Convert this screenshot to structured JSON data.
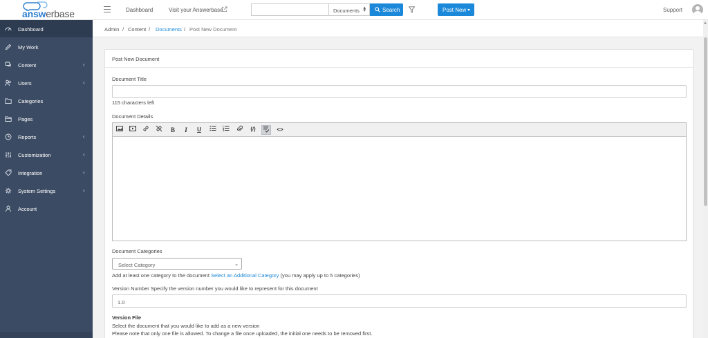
{
  "header": {
    "logo_text_1": "answ",
    "logo_text_2": "erbase",
    "nav_dashboard": "Dashboard",
    "nav_visit": "Visit your Answerbase",
    "search_value": "",
    "search_scope": "Documents",
    "search_button": "Search",
    "post_new": "Post New",
    "support": "Support",
    "accent_color": "#1b88d9"
  },
  "sidebar": {
    "background": "#3b4b63",
    "items": [
      {
        "label": "Dashboard",
        "icon": "speedometer-icon",
        "chevron": ""
      },
      {
        "label": "My Work",
        "icon": "pencil-icon",
        "chevron": ""
      },
      {
        "label": "Content",
        "icon": "chat-bubbles-icon",
        "chevron": "‹"
      },
      {
        "label": "Users",
        "icon": "users-icon",
        "chevron": "‹"
      },
      {
        "label": "Categories",
        "icon": "folder-icon",
        "chevron": ""
      },
      {
        "label": "Pages",
        "icon": "folder-open-icon",
        "chevron": ""
      },
      {
        "label": "Reports",
        "icon": "clock-icon",
        "chevron": "‹"
      },
      {
        "label": "Customization",
        "icon": "sliders-icon",
        "chevron": "‹"
      },
      {
        "label": "Integration",
        "icon": "tag-icon",
        "chevron": "‹"
      },
      {
        "label": "System Settings",
        "icon": "gear-icon",
        "chevron": "‹"
      },
      {
        "label": "Account",
        "icon": "user-icon",
        "chevron": ""
      }
    ]
  },
  "breadcrumb": {
    "admin": "Admin",
    "content": "Content",
    "documents": "Documents",
    "current": "Post New Document",
    "sep": "/"
  },
  "form": {
    "card_title": "Post New Document",
    "title_label": "Document Title",
    "title_value": "",
    "chars_left": "115 characters left",
    "details_label": "Document Details",
    "toolbar_tools": [
      "image-icon",
      "video-icon",
      "link-icon",
      "unlink-icon",
      "bold-icon",
      "italic-icon",
      "underline-icon",
      "bullet-list-icon",
      "numbered-list-icon",
      "attachment-icon",
      "code-block-icon",
      "spellcheck-icon",
      "source-code-icon"
    ],
    "categories_label": "Document Categories",
    "category_select": "Select Category",
    "categories_help_pre": "Add at least one category to the document",
    "categories_help_link": "Select an Additional Category",
    "categories_help_post": "(you may apply up to 5 categories)",
    "version_label": "Version Number Specify the version number you would like to represent for this document",
    "version_value": "1.0",
    "file_label": "Version File",
    "file_help_1": "Select the document that you would like to add as a new version",
    "file_help_2": "Please note that only one file is allowed. To change a file once uploaded, the initial one needs to be removed first."
  }
}
